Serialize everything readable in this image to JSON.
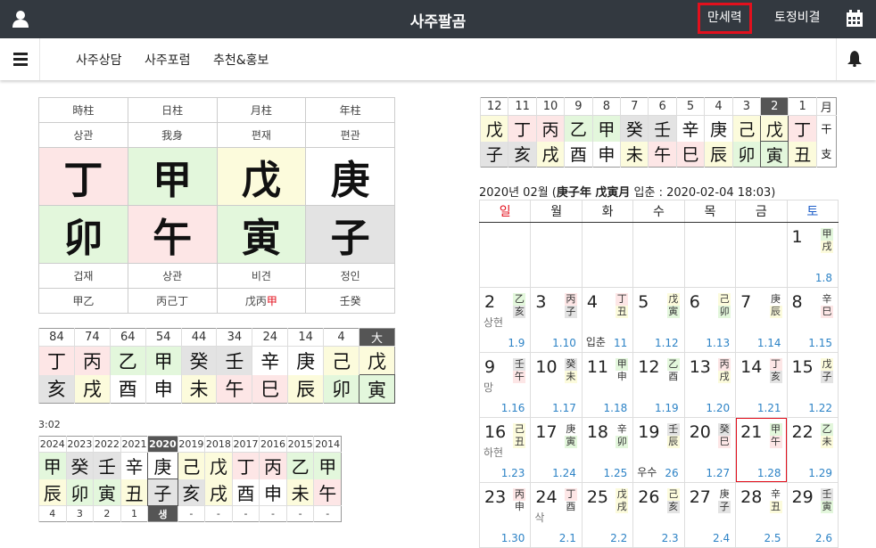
{
  "header": {
    "title": "사주팔곰",
    "nav": [
      "만세력",
      "토정비결"
    ],
    "user_icon": "user-icon",
    "calendar_icon": "calendar-icon"
  },
  "subnav": {
    "items": [
      "사주상담",
      "사주포럼",
      "추천&홍보"
    ]
  },
  "pillars": {
    "headers": [
      "時柱",
      "日柱",
      "月柱",
      "年柱"
    ],
    "ten_gods_top": [
      "상관",
      "我身",
      "편재",
      "편관"
    ],
    "stems": [
      "丁",
      "甲",
      "戊",
      "庚"
    ],
    "branches": [
      "卯",
      "午",
      "寅",
      "子"
    ],
    "ten_gods_bottom": [
      "겁재",
      "상관",
      "비견",
      "정인"
    ],
    "hidden": [
      "甲乙",
      "丙己丁",
      "戊丙",
      "壬癸"
    ],
    "hidden_red": [
      "",
      "",
      "甲",
      ""
    ]
  },
  "daeun": {
    "ages": [
      "84",
      "74",
      "64",
      "54",
      "44",
      "34",
      "24",
      "14",
      "4",
      "大"
    ],
    "stems": [
      "丁",
      "丙",
      "乙",
      "甲",
      "癸",
      "壬",
      "辛",
      "庚",
      "己",
      "戊"
    ],
    "branches": [
      "亥",
      "戌",
      "酉",
      "申",
      "未",
      "午",
      "巳",
      "辰",
      "卯",
      "寅"
    ]
  },
  "seun": {
    "corner": "3:02",
    "years": [
      "2024",
      "2023",
      "2022",
      "2021",
      "2020",
      "2019",
      "2018",
      "2017",
      "2016",
      "2015",
      "2014"
    ],
    "stems": [
      "甲",
      "癸",
      "壬",
      "辛",
      "庚",
      "己",
      "戊",
      "丁",
      "丙",
      "乙",
      "甲"
    ],
    "branches": [
      "辰",
      "卯",
      "寅",
      "丑",
      "子",
      "亥",
      "戌",
      "酉",
      "申",
      "未",
      "午"
    ],
    "ages": [
      "4",
      "3",
      "2",
      "1",
      "생",
      "-",
      "-",
      "-",
      "-",
      "-",
      "-"
    ]
  },
  "wolun": {
    "months": [
      "12",
      "11",
      "10",
      "9",
      "8",
      "7",
      "6",
      "5",
      "4",
      "3",
      "2",
      "1",
      "月"
    ],
    "stems": [
      "戊",
      "丁",
      "丙",
      "乙",
      "甲",
      "癸",
      "壬",
      "辛",
      "庚",
      "己",
      "戊",
      "丁",
      "干"
    ],
    "branches": [
      "子",
      "亥",
      "戌",
      "酉",
      "申",
      "未",
      "午",
      "巳",
      "辰",
      "卯",
      "寅",
      "丑",
      "支"
    ]
  },
  "calendar": {
    "month_prefix": "2020년 02월 (",
    "month_gz": "庚子年 戊寅月",
    "month_suffix": " 입춘 : 2020-02-04 18:03)",
    "weekdays": [
      "일",
      "월",
      "화",
      "수",
      "목",
      "금",
      "토"
    ],
    "colors": {
      "sunday": "#e3101d",
      "saturday": "#1f5fc9",
      "lunar": "#2d83c6",
      "today_border": "#e3101d"
    },
    "weeks": [
      [
        null,
        null,
        null,
        null,
        null,
        null,
        {
          "d": "1",
          "g": "甲戌",
          "l": "1.8"
        }
      ],
      [
        {
          "d": "2",
          "g": "乙亥",
          "l": "1.9",
          "p": "상현"
        },
        {
          "d": "3",
          "g": "丙子",
          "l": "1.10"
        },
        {
          "d": "4",
          "g": "丁丑",
          "l": "11",
          "t": "입춘"
        },
        {
          "d": "5",
          "g": "戊寅",
          "l": "1.12"
        },
        {
          "d": "6",
          "g": "己卯",
          "l": "1.13"
        },
        {
          "d": "7",
          "g": "庚辰",
          "l": "1.14"
        },
        {
          "d": "8",
          "g": "辛巳",
          "l": "1.15"
        }
      ],
      [
        {
          "d": "9",
          "g": "壬午",
          "l": "1.16",
          "p": "망"
        },
        {
          "d": "10",
          "g": "癸未",
          "l": "1.17"
        },
        {
          "d": "11",
          "g": "甲申",
          "l": "1.18"
        },
        {
          "d": "12",
          "g": "乙酉",
          "l": "1.19"
        },
        {
          "d": "13",
          "g": "丙戌",
          "l": "1.20"
        },
        {
          "d": "14",
          "g": "丁亥",
          "l": "1.21"
        },
        {
          "d": "15",
          "g": "戊子",
          "l": "1.22"
        }
      ],
      [
        {
          "d": "16",
          "g": "己丑",
          "l": "1.23",
          "p": "하현"
        },
        {
          "d": "17",
          "g": "庚寅",
          "l": "1.24"
        },
        {
          "d": "18",
          "g": "辛卯",
          "l": "1.25"
        },
        {
          "d": "19",
          "g": "壬辰",
          "l": "26",
          "t": "우수"
        },
        {
          "d": "20",
          "g": "癸巳",
          "l": "1.27"
        },
        {
          "d": "21",
          "g": "甲午",
          "l": "1.28",
          "today": true
        },
        {
          "d": "22",
          "g": "乙未",
          "l": "1.29"
        }
      ],
      [
        {
          "d": "23",
          "g": "丙申",
          "l": "1.30"
        },
        {
          "d": "24",
          "g": "丁酉",
          "l": "2.1",
          "p": "삭"
        },
        {
          "d": "25",
          "g": "戊戌",
          "l": "2.2"
        },
        {
          "d": "26",
          "g": "己亥",
          "l": "2.3"
        },
        {
          "d": "27",
          "g": "庚子",
          "l": "2.4"
        },
        {
          "d": "28",
          "g": "辛丑",
          "l": "2.5"
        },
        {
          "d": "29",
          "g": "壬寅",
          "l": "2.6"
        }
      ]
    ]
  }
}
